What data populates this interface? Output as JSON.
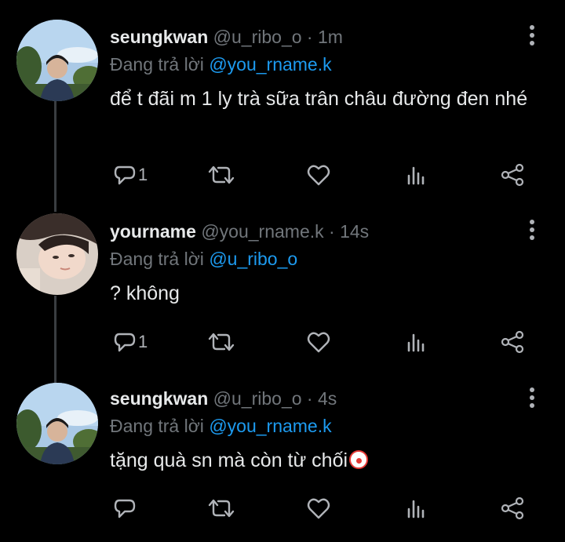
{
  "colors": {
    "background": "#000000",
    "text": "#e7e9ea",
    "muted": "#71767b",
    "mention": "#1d9bf0",
    "thread_line": "#3a3d41"
  },
  "tweets": [
    {
      "display_name": "seungkwan",
      "meta": " @u_ribo_o · 1m",
      "reply_prefix": "Đang trả lời ",
      "reply_to": "@you_rname.k",
      "text": "để t đãi m 1 ly trà sữa trân châu đường đen nhé",
      "reply_count": "1",
      "avatar": "seungkwan-avatar"
    },
    {
      "display_name": "yourname",
      "meta": " @you_rname.k · 14s",
      "reply_prefix": "Đang trả lời ",
      "reply_to": "@u_ribo_o",
      "text": "? không",
      "reply_count": "1",
      "avatar": "yourname-avatar"
    },
    {
      "display_name": "seungkwan",
      "meta": " @u_ribo_o · 4s",
      "reply_prefix": "Đang trả lời ",
      "reply_to": "@you_rname.k",
      "text": "tặng quà sn mà còn từ chối",
      "reply_count": "",
      "emoji": "clown-face-emoji",
      "avatar": "seungkwan-avatar"
    }
  ],
  "icons": [
    "reply-icon",
    "retweet-icon",
    "like-icon",
    "views-icon",
    "share-icon",
    "more-icon"
  ]
}
